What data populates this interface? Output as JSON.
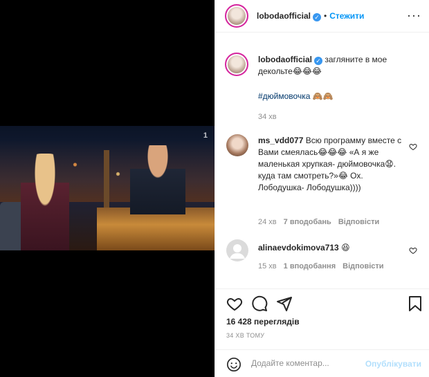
{
  "post": {
    "author": "lobodaofficial",
    "follow_label": "Стежити",
    "dot": "•",
    "more_label": "···",
    "caption": {
      "username": "lobodaofficial",
      "text": "загляните в мое декольте😂😂😂",
      "hashtag": "#дюймовочка 🙈🙈",
      "time": "34 хв"
    },
    "comments": [
      {
        "username": "ms_vdd077",
        "text": "Всю программу вместе с Вами смеялась😂😂😂 «А я же маленькая хрупкая- дюймовочка😧. куда там смотреть?»😂 Ох. Лободушка- Лободушка))))",
        "time": "24 хв",
        "likes": "7 вподобань",
        "reply": "Відповісти"
      },
      {
        "username": "alinaevdokimova713",
        "text": "😆",
        "time": "15 хв",
        "likes": "1 вподобання",
        "reply": "Відповісти"
      }
    ],
    "views": "16 428 переглядів",
    "time_ago": "34 ХВ ТОМУ",
    "add_comment_placeholder": "Додайте коментар...",
    "post_button": "Опублікувати"
  },
  "video": {
    "channel_mark": "1"
  },
  "colors": {
    "accent": "#0095f6",
    "verified": "#3897f0",
    "post_disabled": "#b2dffc",
    "muted": "#8e8e8e",
    "hashtag": "#00376b"
  },
  "icons": [
    "verified-badge-icon",
    "more-options-icon",
    "heart-icon",
    "comment-icon",
    "share-icon",
    "bookmark-icon",
    "emoji-icon",
    "heart-small-icon"
  ]
}
